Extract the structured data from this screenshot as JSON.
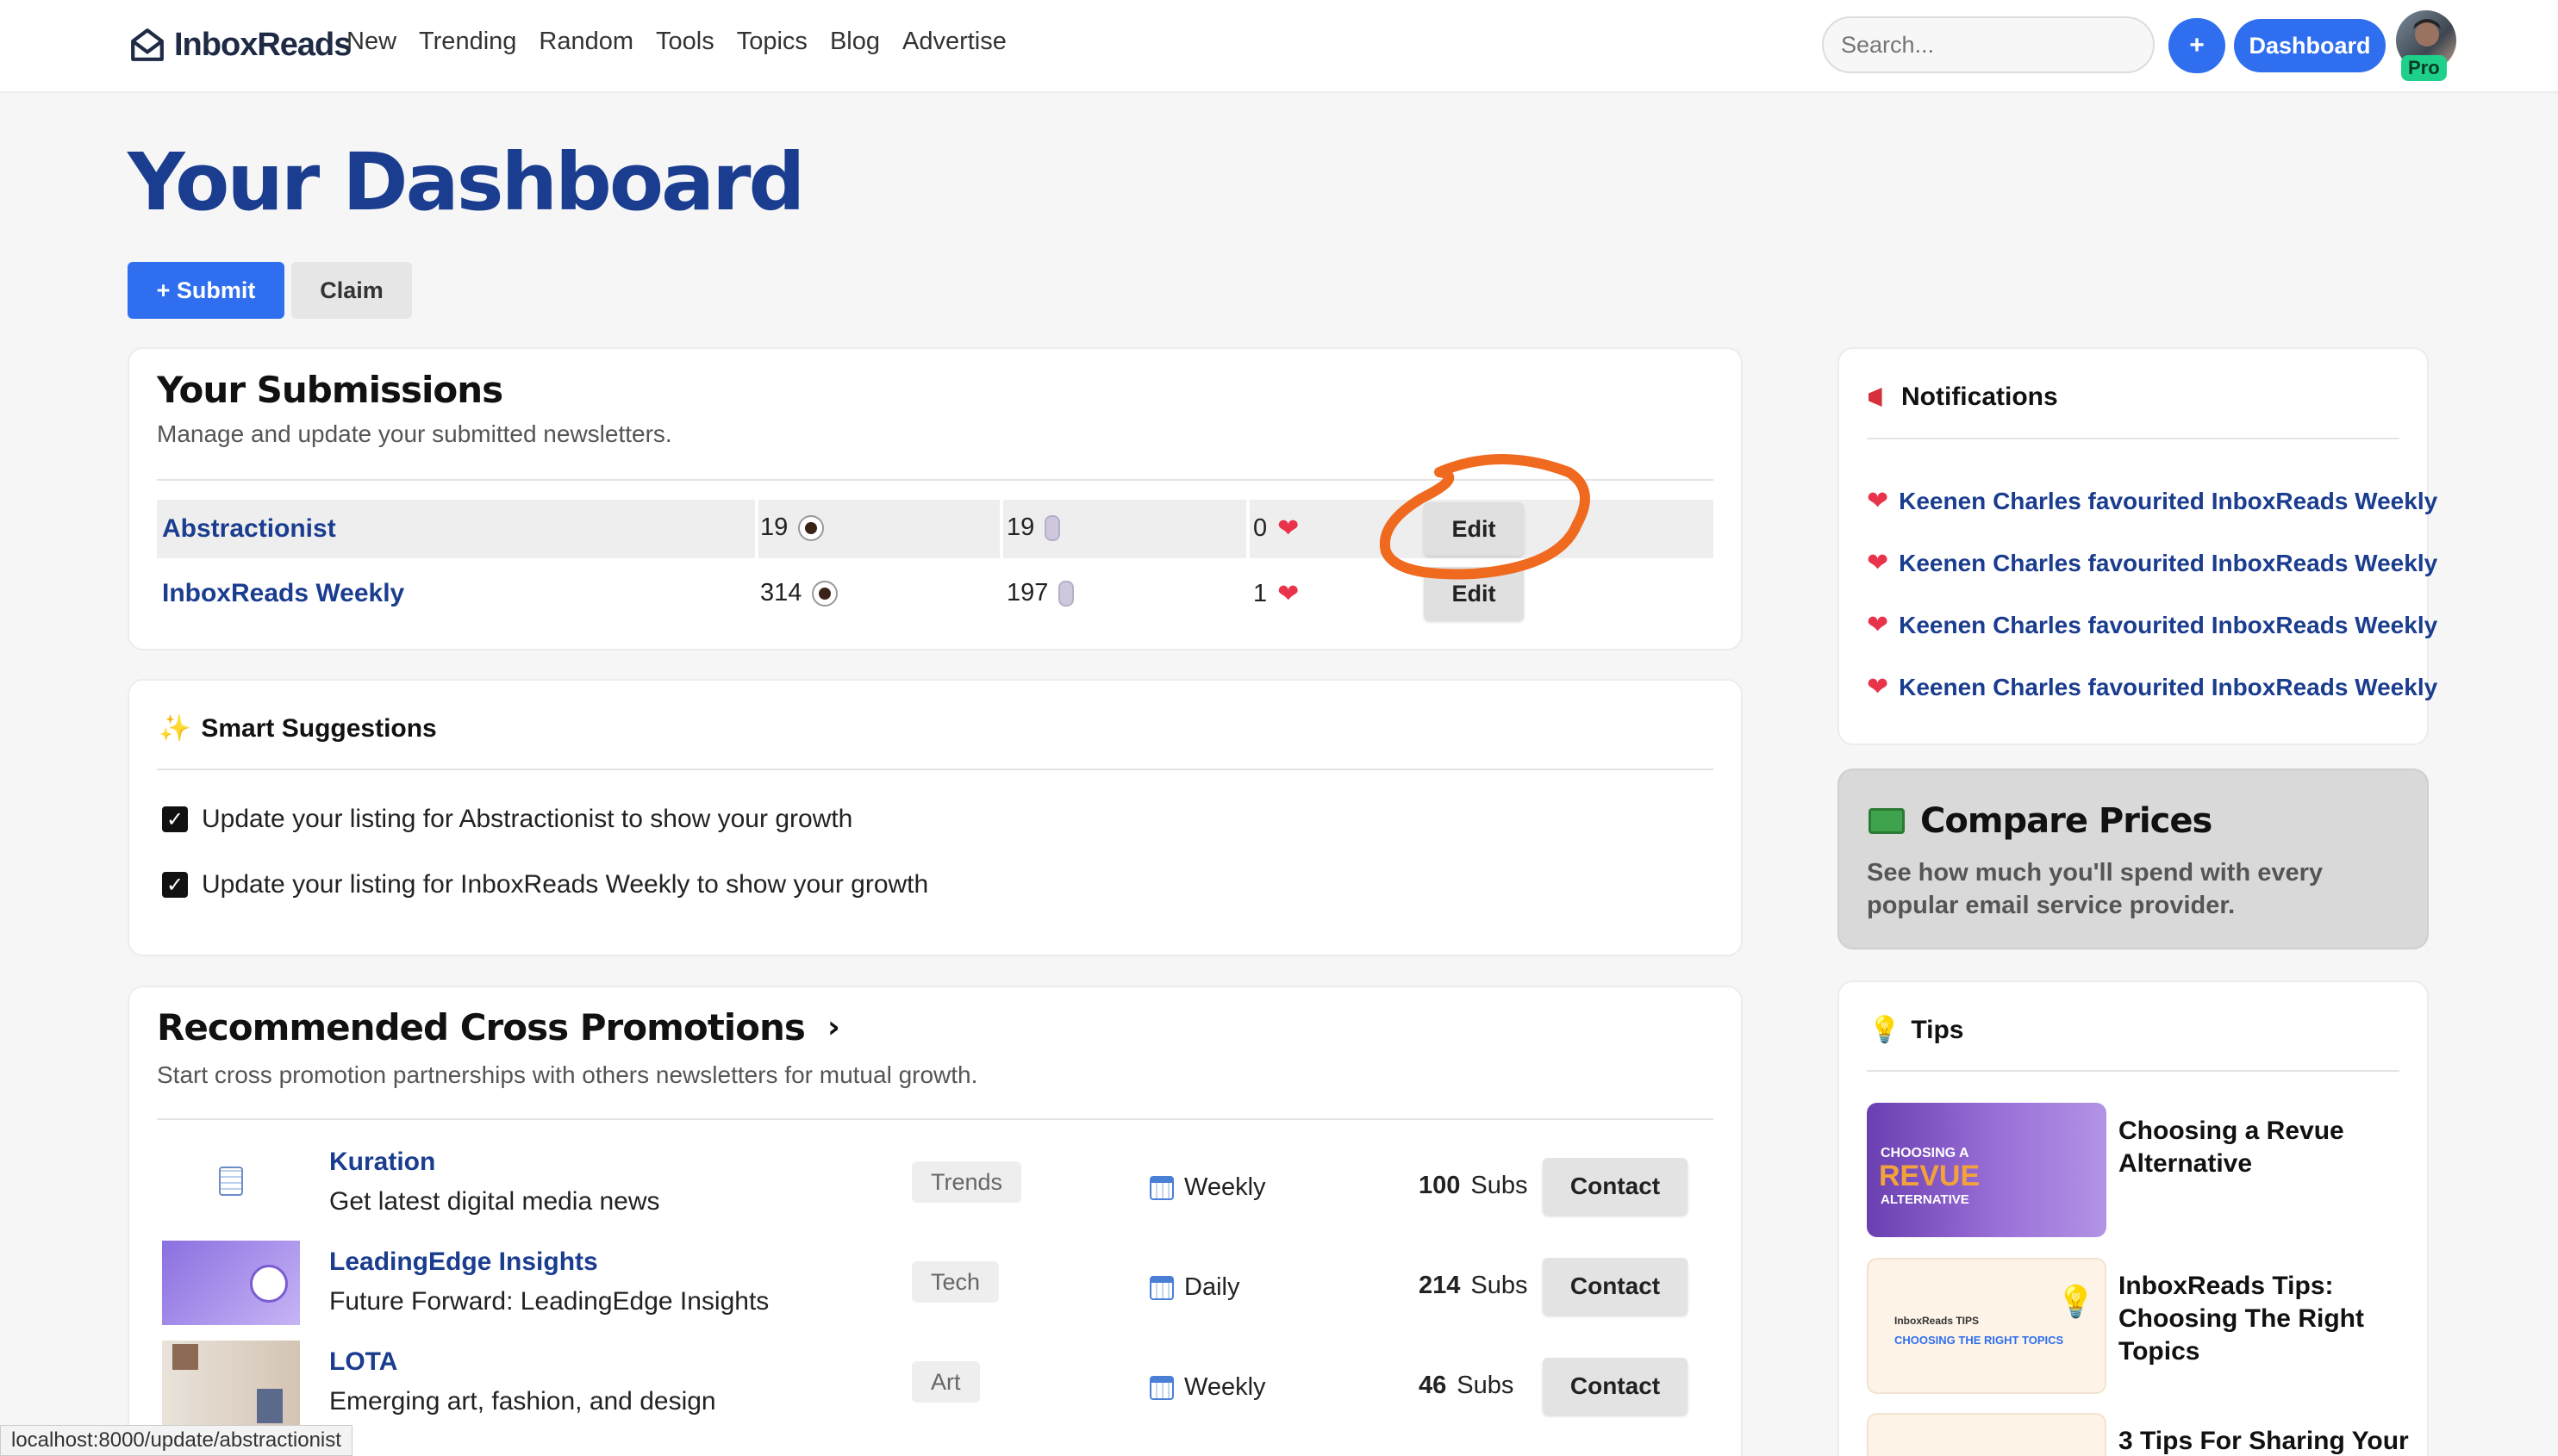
{
  "nav": {
    "logo": "InboxReads",
    "links": [
      "New",
      "Trending",
      "Random",
      "Tools",
      "Topics",
      "Blog",
      "Advertise"
    ],
    "search_placeholder": "Search...",
    "plus_label": "+",
    "dashboard_label": "Dashboard",
    "pro_badge": "Pro"
  },
  "page": {
    "title": "Your Dashboard",
    "submit_label": "+ Submit",
    "claim_label": "Claim"
  },
  "submissions": {
    "title": "Your Submissions",
    "subtitle": "Manage and update your submitted newsletters.",
    "rows": [
      {
        "name": "Abstractionist",
        "views": "19",
        "clicks": "19",
        "favs": "0",
        "edit": "Edit"
      },
      {
        "name": "InboxReads Weekly",
        "views": "314",
        "clicks": "197",
        "favs": "1",
        "edit": "Edit"
      }
    ]
  },
  "suggestions": {
    "title": "Smart Suggestions",
    "items": [
      "Update your listing for Abstractionist to show your growth",
      "Update your listing for InboxReads Weekly to show your growth"
    ]
  },
  "cross": {
    "title": "Recommended Cross Promotions",
    "subtitle": "Start cross promotion partnerships with others newsletters for mutual growth.",
    "rows": [
      {
        "name": "Kuration",
        "desc": "Get latest digital media news",
        "tag": "Trends",
        "freq": "Weekly",
        "subs": "100",
        "subs_unit": "Subs",
        "contact": "Contact"
      },
      {
        "name": "LeadingEdge Insights",
        "desc": "Future Forward: LeadingEdge Insights",
        "tag": "Tech",
        "freq": "Daily",
        "subs": "214",
        "subs_unit": "Subs",
        "contact": "Contact"
      },
      {
        "name": "LOTA",
        "desc": "Emerging art, fashion, and design",
        "tag": "Art",
        "freq": "Weekly",
        "subs": "46",
        "subs_unit": "Subs",
        "contact": "Contact"
      }
    ]
  },
  "notifications": {
    "title": "Notifications",
    "items": [
      "Keenen Charles favourited InboxReads Weekly",
      "Keenen Charles favourited InboxReads Weekly",
      "Keenen Charles favourited InboxReads Weekly",
      "Keenen Charles favourited InboxReads Weekly"
    ]
  },
  "compare": {
    "title": "Compare Prices",
    "text": "See how much you'll spend with every popular email service provider."
  },
  "tips": {
    "title": "Tips",
    "items": [
      {
        "title": "Choosing a Revue Alternative",
        "img_text_1": "CHOOSING A",
        "img_text_2": "REVUE",
        "img_text_3": "ALTERNATIVE"
      },
      {
        "title": "InboxReads Tips: Choosing The Right Topics",
        "img_text_1": "InboxReads TIPS",
        "img_text_2": "CHOOSING THE RIGHT TOPICS"
      },
      {
        "title": "3 Tips For Sharing Your"
      }
    ]
  },
  "status_url": "localhost:8000/update/abstractionist",
  "colors": {
    "accent": "#2f6fef",
    "link": "#1b3d8f",
    "annotation": "#ef6a1f"
  }
}
